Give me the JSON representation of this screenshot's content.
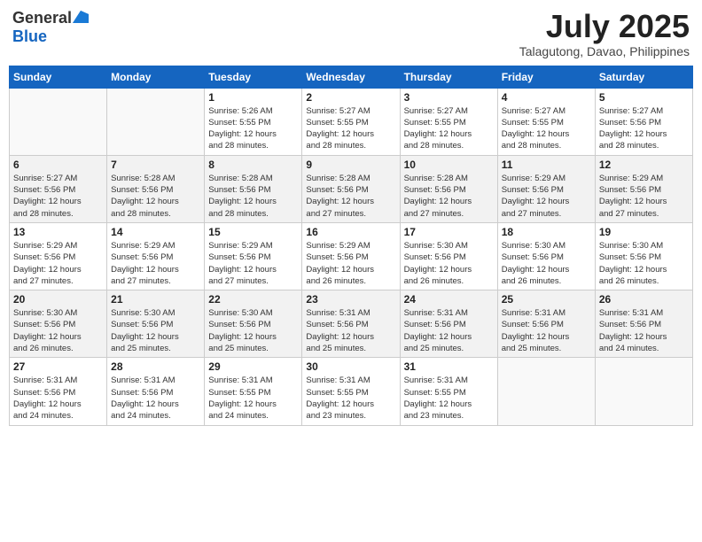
{
  "logo": {
    "general": "General",
    "blue": "Blue"
  },
  "title": {
    "month_year": "July 2025",
    "location": "Talagutong, Davao, Philippines"
  },
  "weekdays": [
    "Sunday",
    "Monday",
    "Tuesday",
    "Wednesday",
    "Thursday",
    "Friday",
    "Saturday"
  ],
  "weeks": [
    [
      {
        "day": "",
        "info": ""
      },
      {
        "day": "",
        "info": ""
      },
      {
        "day": "1",
        "info": "Sunrise: 5:26 AM\nSunset: 5:55 PM\nDaylight: 12 hours\nand 28 minutes."
      },
      {
        "day": "2",
        "info": "Sunrise: 5:27 AM\nSunset: 5:55 PM\nDaylight: 12 hours\nand 28 minutes."
      },
      {
        "day": "3",
        "info": "Sunrise: 5:27 AM\nSunset: 5:55 PM\nDaylight: 12 hours\nand 28 minutes."
      },
      {
        "day": "4",
        "info": "Sunrise: 5:27 AM\nSunset: 5:55 PM\nDaylight: 12 hours\nand 28 minutes."
      },
      {
        "day": "5",
        "info": "Sunrise: 5:27 AM\nSunset: 5:56 PM\nDaylight: 12 hours\nand 28 minutes."
      }
    ],
    [
      {
        "day": "6",
        "info": "Sunrise: 5:27 AM\nSunset: 5:56 PM\nDaylight: 12 hours\nand 28 minutes."
      },
      {
        "day": "7",
        "info": "Sunrise: 5:28 AM\nSunset: 5:56 PM\nDaylight: 12 hours\nand 28 minutes."
      },
      {
        "day": "8",
        "info": "Sunrise: 5:28 AM\nSunset: 5:56 PM\nDaylight: 12 hours\nand 28 minutes."
      },
      {
        "day": "9",
        "info": "Sunrise: 5:28 AM\nSunset: 5:56 PM\nDaylight: 12 hours\nand 27 minutes."
      },
      {
        "day": "10",
        "info": "Sunrise: 5:28 AM\nSunset: 5:56 PM\nDaylight: 12 hours\nand 27 minutes."
      },
      {
        "day": "11",
        "info": "Sunrise: 5:29 AM\nSunset: 5:56 PM\nDaylight: 12 hours\nand 27 minutes."
      },
      {
        "day": "12",
        "info": "Sunrise: 5:29 AM\nSunset: 5:56 PM\nDaylight: 12 hours\nand 27 minutes."
      }
    ],
    [
      {
        "day": "13",
        "info": "Sunrise: 5:29 AM\nSunset: 5:56 PM\nDaylight: 12 hours\nand 27 minutes."
      },
      {
        "day": "14",
        "info": "Sunrise: 5:29 AM\nSunset: 5:56 PM\nDaylight: 12 hours\nand 27 minutes."
      },
      {
        "day": "15",
        "info": "Sunrise: 5:29 AM\nSunset: 5:56 PM\nDaylight: 12 hours\nand 27 minutes."
      },
      {
        "day": "16",
        "info": "Sunrise: 5:29 AM\nSunset: 5:56 PM\nDaylight: 12 hours\nand 26 minutes."
      },
      {
        "day": "17",
        "info": "Sunrise: 5:30 AM\nSunset: 5:56 PM\nDaylight: 12 hours\nand 26 minutes."
      },
      {
        "day": "18",
        "info": "Sunrise: 5:30 AM\nSunset: 5:56 PM\nDaylight: 12 hours\nand 26 minutes."
      },
      {
        "day": "19",
        "info": "Sunrise: 5:30 AM\nSunset: 5:56 PM\nDaylight: 12 hours\nand 26 minutes."
      }
    ],
    [
      {
        "day": "20",
        "info": "Sunrise: 5:30 AM\nSunset: 5:56 PM\nDaylight: 12 hours\nand 26 minutes."
      },
      {
        "day": "21",
        "info": "Sunrise: 5:30 AM\nSunset: 5:56 PM\nDaylight: 12 hours\nand 25 minutes."
      },
      {
        "day": "22",
        "info": "Sunrise: 5:30 AM\nSunset: 5:56 PM\nDaylight: 12 hours\nand 25 minutes."
      },
      {
        "day": "23",
        "info": "Sunrise: 5:31 AM\nSunset: 5:56 PM\nDaylight: 12 hours\nand 25 minutes."
      },
      {
        "day": "24",
        "info": "Sunrise: 5:31 AM\nSunset: 5:56 PM\nDaylight: 12 hours\nand 25 minutes."
      },
      {
        "day": "25",
        "info": "Sunrise: 5:31 AM\nSunset: 5:56 PM\nDaylight: 12 hours\nand 25 minutes."
      },
      {
        "day": "26",
        "info": "Sunrise: 5:31 AM\nSunset: 5:56 PM\nDaylight: 12 hours\nand 24 minutes."
      }
    ],
    [
      {
        "day": "27",
        "info": "Sunrise: 5:31 AM\nSunset: 5:56 PM\nDaylight: 12 hours\nand 24 minutes."
      },
      {
        "day": "28",
        "info": "Sunrise: 5:31 AM\nSunset: 5:56 PM\nDaylight: 12 hours\nand 24 minutes."
      },
      {
        "day": "29",
        "info": "Sunrise: 5:31 AM\nSunset: 5:55 PM\nDaylight: 12 hours\nand 24 minutes."
      },
      {
        "day": "30",
        "info": "Sunrise: 5:31 AM\nSunset: 5:55 PM\nDaylight: 12 hours\nand 23 minutes."
      },
      {
        "day": "31",
        "info": "Sunrise: 5:31 AM\nSunset: 5:55 PM\nDaylight: 12 hours\nand 23 minutes."
      },
      {
        "day": "",
        "info": ""
      },
      {
        "day": "",
        "info": ""
      }
    ]
  ]
}
